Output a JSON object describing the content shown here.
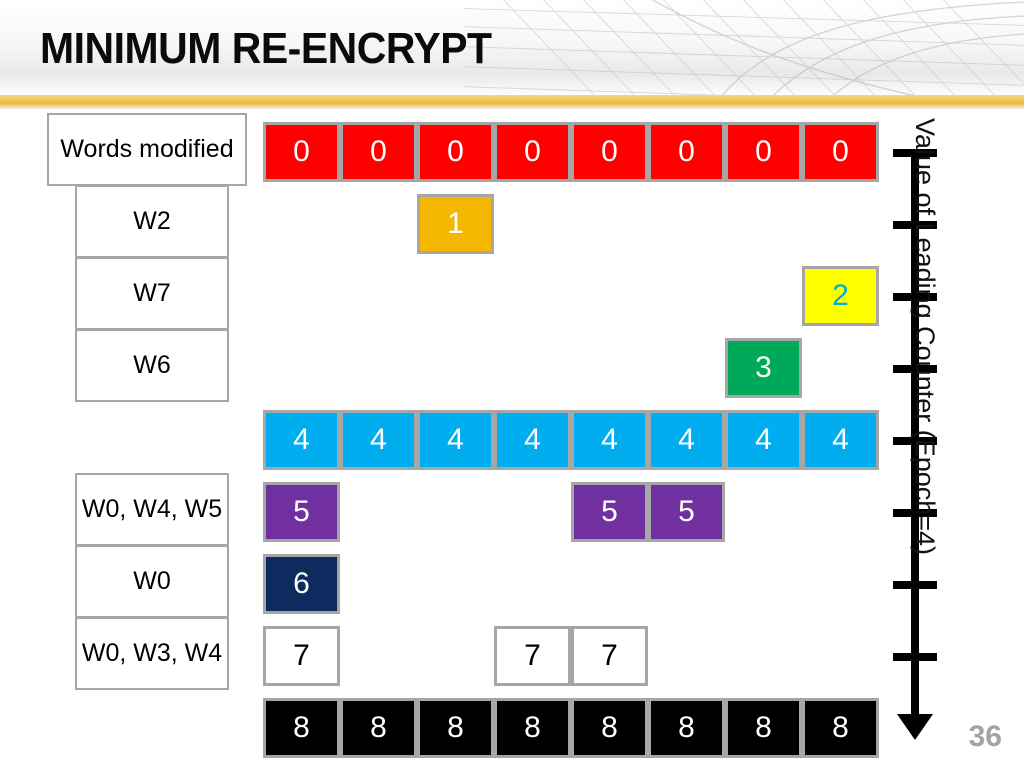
{
  "slide": {
    "title": "MINIMUM RE-ENCRYPT",
    "number": "36",
    "accent_color": "#E8B945"
  },
  "left_labels": [
    {
      "text": "Words modified",
      "style": "wide",
      "row": 0
    },
    {
      "text": "W2",
      "style": "narrow",
      "row": 1
    },
    {
      "text": "W7",
      "style": "narrow",
      "row": 2
    },
    {
      "text": "W6",
      "style": "narrow",
      "row": 3
    },
    {
      "text": "W0, W4, W5",
      "style": "narrow",
      "row": 5
    },
    {
      "text": "W0",
      "style": "narrow",
      "row": 6
    },
    {
      "text": "W0, W3, W4",
      "style": "narrow",
      "row": 7
    }
  ],
  "grid": {
    "columns": 8,
    "rows": [
      {
        "value": "0",
        "fill": "#FF0000",
        "text_color": "#FFFFFF",
        "border": "#a6a6a6",
        "cols": [
          0,
          1,
          2,
          3,
          4,
          5,
          6,
          7
        ]
      },
      {
        "value": "1",
        "fill": "#F5B800",
        "text_color": "#FFFFFF",
        "border": "#a6a6a6",
        "cols": [
          2
        ]
      },
      {
        "value": "2",
        "fill": "#FFFF00",
        "text_color": "#00B0C8",
        "border": "#a6a6a6",
        "cols": [
          7
        ]
      },
      {
        "value": "3",
        "fill": "#00A859",
        "text_color": "#FFFFFF",
        "border": "#a6a6a6",
        "cols": [
          6
        ]
      },
      {
        "value": "4",
        "fill": "#00AEEF",
        "text_color": "#FFFFFF",
        "border": "#a6a6a6",
        "cols": [
          0,
          1,
          2,
          3,
          4,
          5,
          6,
          7
        ]
      },
      {
        "value": "5",
        "fill": "#7030A0",
        "text_color": "#FFFFFF",
        "border": "#a6a6a6",
        "cols": [
          0,
          4,
          5
        ]
      },
      {
        "value": "6",
        "fill": "#0D2B5E",
        "text_color": "#FFFFFF",
        "border": "#a6a6a6",
        "cols": [
          0
        ]
      },
      {
        "value": "7",
        "fill": "#FFFFFF",
        "text_color": "#000000",
        "border": "#a6a6a6",
        "cols": [
          0,
          3,
          4
        ]
      },
      {
        "value": "8",
        "fill": "#000000",
        "text_color": "#FFFFFF",
        "border": "#a6a6a6",
        "cols": [
          0,
          1,
          2,
          3,
          4,
          5,
          6,
          7
        ]
      }
    ]
  },
  "axis": {
    "label": "Value of Leading Counter (Epoch=4)",
    "tick_count": 8,
    "direction": "down"
  }
}
